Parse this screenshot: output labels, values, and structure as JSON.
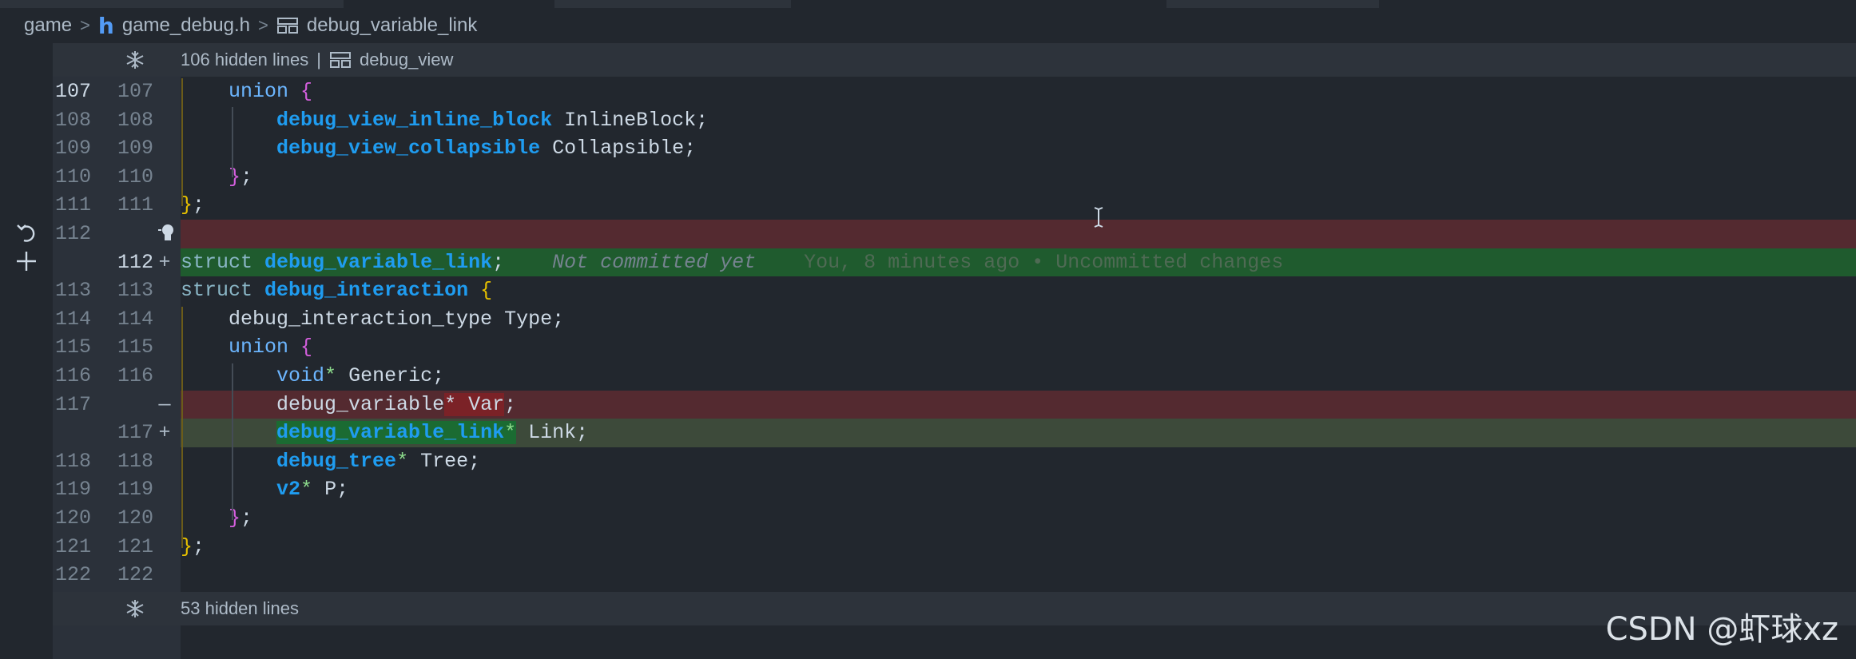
{
  "breadcrumb": {
    "folder": "game",
    "file": "game_debug.h",
    "symbol": "debug_variable_link"
  },
  "hidden_top": {
    "count_label": "106 hidden lines",
    "divider": "|",
    "symbol": "debug_view"
  },
  "hidden_bottom": {
    "count_label": "53 hidden lines"
  },
  "lines": [
    {
      "old": "107",
      "new": "107",
      "mark": "",
      "segments": [
        {
          "t": "    "
        },
        {
          "t": "union",
          "c": "kw"
        },
        {
          "t": " "
        },
        {
          "t": "{",
          "c": "br-p"
        }
      ]
    },
    {
      "old": "108",
      "new": "108",
      "mark": "",
      "segments": [
        {
          "t": "        "
        },
        {
          "t": "debug_view_inline_block",
          "c": "ty"
        },
        {
          "t": " InlineBlock;",
          "c": "plain"
        }
      ]
    },
    {
      "old": "109",
      "new": "109",
      "mark": "",
      "segments": [
        {
          "t": "        "
        },
        {
          "t": "debug_view_collapsible",
          "c": "ty"
        },
        {
          "t": " Collapsible;",
          "c": "plain"
        }
      ]
    },
    {
      "old": "110",
      "new": "110",
      "mark": "",
      "segments": [
        {
          "t": "    "
        },
        {
          "t": "}",
          "c": "br-p"
        },
        {
          "t": ";",
          "c": "plain"
        }
      ]
    },
    {
      "old": "111",
      "new": "111",
      "mark": "",
      "segments": [
        {
          "t": "}",
          "c": "br-y"
        },
        {
          "t": ";",
          "c": "plain"
        }
      ]
    },
    {
      "old": "112",
      "new": "",
      "mark": "",
      "segments": []
    },
    {
      "old": "",
      "new": "112",
      "mark": "+",
      "segments": [
        {
          "t": "struct",
          "c": "struct-kw"
        },
        {
          "t": " "
        },
        {
          "t": "debug_variable_link",
          "c": "ty"
        },
        {
          "t": ";",
          "c": "plain"
        },
        {
          "t": "    Not committed yet",
          "c": "ghost-a"
        },
        {
          "t": "    You, 8 minutes ago • Uncommitted changes",
          "c": "ghost-b"
        }
      ]
    },
    {
      "old": "113",
      "new": "113",
      "mark": "",
      "segments": [
        {
          "t": "struct",
          "c": "struct-kw"
        },
        {
          "t": " "
        },
        {
          "t": "debug_interaction",
          "c": "ty"
        },
        {
          "t": " "
        },
        {
          "t": "{",
          "c": "br-y"
        }
      ]
    },
    {
      "old": "114",
      "new": "114",
      "mark": "",
      "segments": [
        {
          "t": "    debug_interaction_type Type;",
          "c": "plain"
        }
      ]
    },
    {
      "old": "115",
      "new": "115",
      "mark": "",
      "segments": [
        {
          "t": "    "
        },
        {
          "t": "union",
          "c": "kw"
        },
        {
          "t": " "
        },
        {
          "t": "{",
          "c": "br-p"
        }
      ]
    },
    {
      "old": "116",
      "new": "116",
      "mark": "",
      "segments": [
        {
          "t": "        "
        },
        {
          "t": "void",
          "c": "kw"
        },
        {
          "t": "*",
          "c": "ptr"
        },
        {
          "t": " Generic;",
          "c": "plain"
        }
      ]
    },
    {
      "old": "117",
      "new": "",
      "mark": "—",
      "segments": [
        {
          "t": "        "
        },
        {
          "t": "debug_variable",
          "c": "plain"
        },
        {
          "t": "* Var",
          "c": "hl-del-ptr"
        },
        {
          "t": ";",
          "c": "plain"
        }
      ]
    },
    {
      "old": "",
      "new": "117",
      "mark": "+",
      "segments": [
        {
          "t": "        "
        },
        {
          "t": "debug_variable_link",
          "c": "ty hl-add"
        },
        {
          "t": "*",
          "c": "ptr hl-add"
        },
        {
          "t": " Link;",
          "c": "plain"
        }
      ]
    },
    {
      "old": "118",
      "new": "118",
      "mark": "",
      "segments": [
        {
          "t": "        "
        },
        {
          "t": "debug_tree",
          "c": "ty"
        },
        {
          "t": "*",
          "c": "ptr"
        },
        {
          "t": " Tree;",
          "c": "plain"
        }
      ]
    },
    {
      "old": "119",
      "new": "119",
      "mark": "",
      "segments": [
        {
          "t": "        "
        },
        {
          "t": "v2",
          "c": "ty"
        },
        {
          "t": "*",
          "c": "ptr"
        },
        {
          "t": " P;",
          "c": "plain"
        }
      ]
    },
    {
      "old": "120",
      "new": "120",
      "mark": "",
      "segments": [
        {
          "t": "    "
        },
        {
          "t": "}",
          "c": "br-p"
        },
        {
          "t": ";",
          "c": "plain"
        }
      ]
    },
    {
      "old": "121",
      "new": "121",
      "mark": "",
      "segments": [
        {
          "t": "}",
          "c": "br-y"
        },
        {
          "t": ";",
          "c": "plain"
        }
      ]
    },
    {
      "old": "122",
      "new": "122",
      "mark": "",
      "segments": []
    }
  ],
  "watermark": "CSDN @虾球xz",
  "colors": {
    "background": "#22272e",
    "deleted_line": "#542a30",
    "added_line": "#1f5b2e",
    "type_blue": "#1f9cf0"
  }
}
